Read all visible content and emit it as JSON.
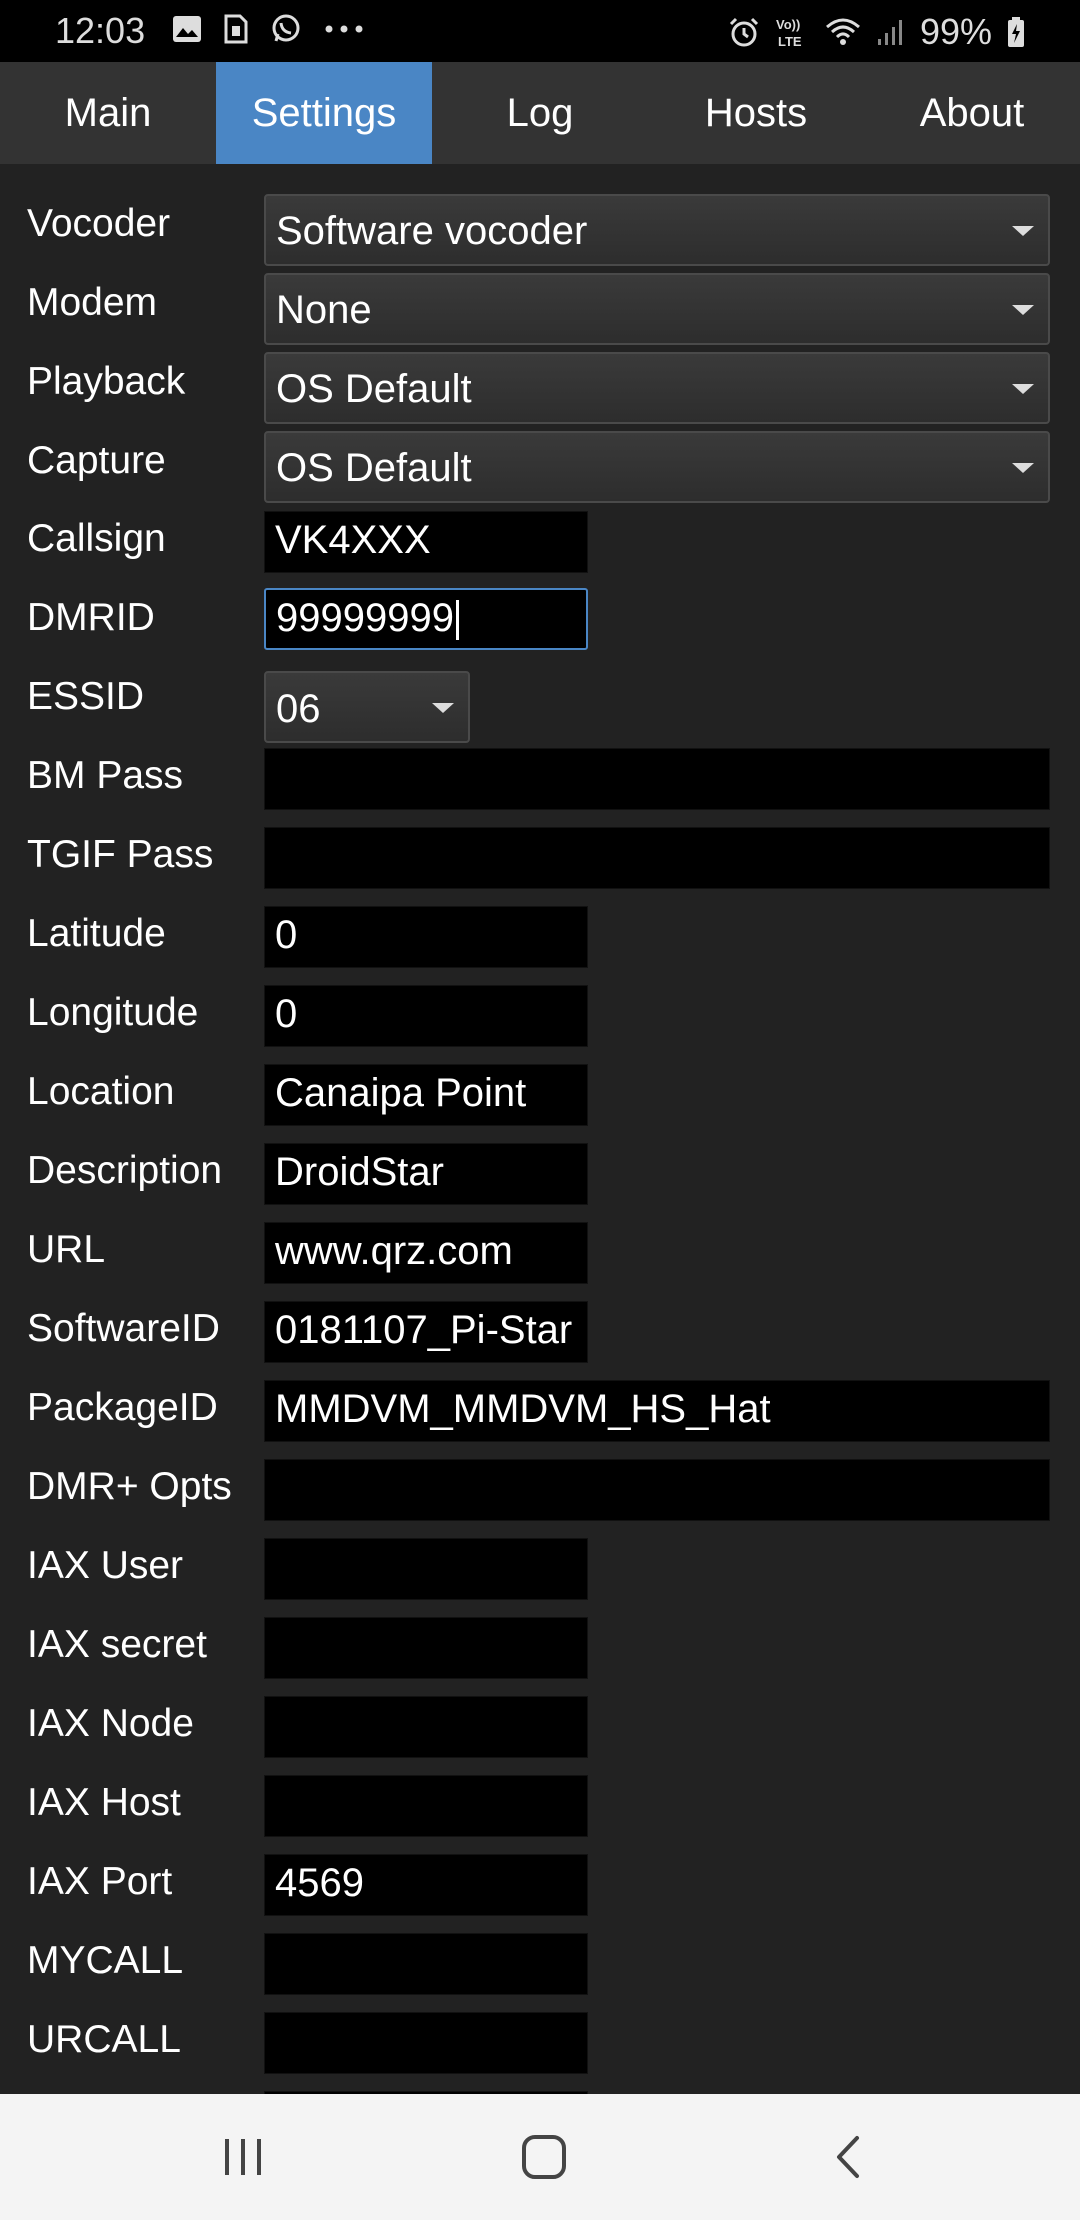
{
  "status_bar": {
    "time": "12:03",
    "battery_percent": "99%",
    "left_icons": [
      "gallery-icon",
      "sim-icon",
      "whatsapp-icon",
      "more-dots-icon"
    ],
    "right_icons": [
      "alarm-icon",
      "volte-icon",
      "wifi-icon",
      "signal-icon",
      "battery-charging-icon"
    ]
  },
  "tabs": [
    {
      "label": "Main",
      "active": false
    },
    {
      "label": "Settings",
      "active": true
    },
    {
      "label": "Log",
      "active": false
    },
    {
      "label": "Hosts",
      "active": false
    },
    {
      "label": "About",
      "active": false
    }
  ],
  "settings": {
    "vocoder": {
      "label": "Vocoder",
      "value": "Software vocoder"
    },
    "modem": {
      "label": "Modem",
      "value": "None"
    },
    "playback": {
      "label": "Playback",
      "value": "OS Default"
    },
    "capture": {
      "label": "Capture",
      "value": "OS Default"
    },
    "callsign": {
      "label": "Callsign",
      "value": "VK4XXX"
    },
    "dmrid": {
      "label": "DMRID",
      "value": "99999999"
    },
    "essid": {
      "label": "ESSID",
      "value": "06"
    },
    "bm_pass": {
      "label": "BM Pass",
      "value": ""
    },
    "tgif_pass": {
      "label": "TGIF Pass",
      "value": ""
    },
    "latitude": {
      "label": "Latitude",
      "value": "0"
    },
    "longitude": {
      "label": "Longitude",
      "value": "0"
    },
    "location": {
      "label": "Location",
      "value": "Canaipa Point"
    },
    "description": {
      "label": "Description",
      "value": "DroidStar"
    },
    "url": {
      "label": "URL",
      "value": "www.qrz.com"
    },
    "software_id": {
      "label": "SoftwareID",
      "value": "0181107_Pi-Star"
    },
    "package_id": {
      "label": "PackageID",
      "value": "MMDVM_MMDVM_HS_Hat"
    },
    "dmr_opts": {
      "label": "DMR+ Opts",
      "value": ""
    },
    "iax_user": {
      "label": "IAX User",
      "value": ""
    },
    "iax_secret": {
      "label": "IAX secret",
      "value": ""
    },
    "iax_node": {
      "label": "IAX Node",
      "value": ""
    },
    "iax_host": {
      "label": "IAX Host",
      "value": ""
    },
    "iax_port": {
      "label": "IAX Port",
      "value": "4569"
    },
    "mycall": {
      "label": "MYCALL",
      "value": ""
    },
    "urcall": {
      "label": "URCALL",
      "value": ""
    }
  },
  "nav_bar": {
    "buttons": [
      "recent-apps-icon",
      "home-icon",
      "back-icon"
    ]
  }
}
